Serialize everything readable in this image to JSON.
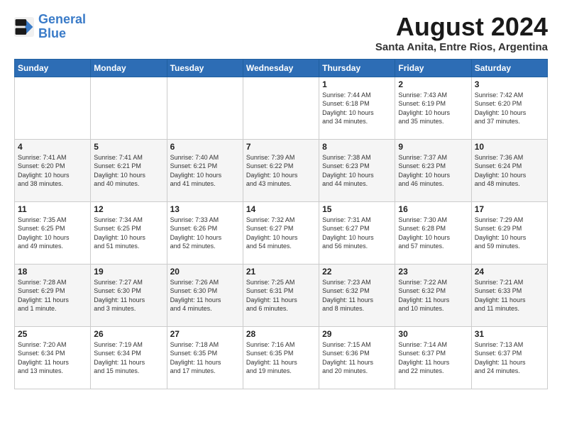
{
  "logo": {
    "line1": "General",
    "line2": "Blue"
  },
  "title": "August 2024",
  "subtitle": "Santa Anita, Entre Rios, Argentina",
  "days_of_week": [
    "Sunday",
    "Monday",
    "Tuesday",
    "Wednesday",
    "Thursday",
    "Friday",
    "Saturday"
  ],
  "weeks": [
    [
      {
        "day": "",
        "content": ""
      },
      {
        "day": "",
        "content": ""
      },
      {
        "day": "",
        "content": ""
      },
      {
        "day": "",
        "content": ""
      },
      {
        "day": "1",
        "content": "Sunrise: 7:44 AM\nSunset: 6:18 PM\nDaylight: 10 hours\nand 34 minutes."
      },
      {
        "day": "2",
        "content": "Sunrise: 7:43 AM\nSunset: 6:19 PM\nDaylight: 10 hours\nand 35 minutes."
      },
      {
        "day": "3",
        "content": "Sunrise: 7:42 AM\nSunset: 6:20 PM\nDaylight: 10 hours\nand 37 minutes."
      }
    ],
    [
      {
        "day": "4",
        "content": "Sunrise: 7:41 AM\nSunset: 6:20 PM\nDaylight: 10 hours\nand 38 minutes."
      },
      {
        "day": "5",
        "content": "Sunrise: 7:41 AM\nSunset: 6:21 PM\nDaylight: 10 hours\nand 40 minutes."
      },
      {
        "day": "6",
        "content": "Sunrise: 7:40 AM\nSunset: 6:21 PM\nDaylight: 10 hours\nand 41 minutes."
      },
      {
        "day": "7",
        "content": "Sunrise: 7:39 AM\nSunset: 6:22 PM\nDaylight: 10 hours\nand 43 minutes."
      },
      {
        "day": "8",
        "content": "Sunrise: 7:38 AM\nSunset: 6:23 PM\nDaylight: 10 hours\nand 44 minutes."
      },
      {
        "day": "9",
        "content": "Sunrise: 7:37 AM\nSunset: 6:23 PM\nDaylight: 10 hours\nand 46 minutes."
      },
      {
        "day": "10",
        "content": "Sunrise: 7:36 AM\nSunset: 6:24 PM\nDaylight: 10 hours\nand 48 minutes."
      }
    ],
    [
      {
        "day": "11",
        "content": "Sunrise: 7:35 AM\nSunset: 6:25 PM\nDaylight: 10 hours\nand 49 minutes."
      },
      {
        "day": "12",
        "content": "Sunrise: 7:34 AM\nSunset: 6:25 PM\nDaylight: 10 hours\nand 51 minutes."
      },
      {
        "day": "13",
        "content": "Sunrise: 7:33 AM\nSunset: 6:26 PM\nDaylight: 10 hours\nand 52 minutes."
      },
      {
        "day": "14",
        "content": "Sunrise: 7:32 AM\nSunset: 6:27 PM\nDaylight: 10 hours\nand 54 minutes."
      },
      {
        "day": "15",
        "content": "Sunrise: 7:31 AM\nSunset: 6:27 PM\nDaylight: 10 hours\nand 56 minutes."
      },
      {
        "day": "16",
        "content": "Sunrise: 7:30 AM\nSunset: 6:28 PM\nDaylight: 10 hours\nand 57 minutes."
      },
      {
        "day": "17",
        "content": "Sunrise: 7:29 AM\nSunset: 6:29 PM\nDaylight: 10 hours\nand 59 minutes."
      }
    ],
    [
      {
        "day": "18",
        "content": "Sunrise: 7:28 AM\nSunset: 6:29 PM\nDaylight: 11 hours\nand 1 minute."
      },
      {
        "day": "19",
        "content": "Sunrise: 7:27 AM\nSunset: 6:30 PM\nDaylight: 11 hours\nand 3 minutes."
      },
      {
        "day": "20",
        "content": "Sunrise: 7:26 AM\nSunset: 6:30 PM\nDaylight: 11 hours\nand 4 minutes."
      },
      {
        "day": "21",
        "content": "Sunrise: 7:25 AM\nSunset: 6:31 PM\nDaylight: 11 hours\nand 6 minutes."
      },
      {
        "day": "22",
        "content": "Sunrise: 7:23 AM\nSunset: 6:32 PM\nDaylight: 11 hours\nand 8 minutes."
      },
      {
        "day": "23",
        "content": "Sunrise: 7:22 AM\nSunset: 6:32 PM\nDaylight: 11 hours\nand 10 minutes."
      },
      {
        "day": "24",
        "content": "Sunrise: 7:21 AM\nSunset: 6:33 PM\nDaylight: 11 hours\nand 11 minutes."
      }
    ],
    [
      {
        "day": "25",
        "content": "Sunrise: 7:20 AM\nSunset: 6:34 PM\nDaylight: 11 hours\nand 13 minutes."
      },
      {
        "day": "26",
        "content": "Sunrise: 7:19 AM\nSunset: 6:34 PM\nDaylight: 11 hours\nand 15 minutes."
      },
      {
        "day": "27",
        "content": "Sunrise: 7:18 AM\nSunset: 6:35 PM\nDaylight: 11 hours\nand 17 minutes."
      },
      {
        "day": "28",
        "content": "Sunrise: 7:16 AM\nSunset: 6:35 PM\nDaylight: 11 hours\nand 19 minutes."
      },
      {
        "day": "29",
        "content": "Sunrise: 7:15 AM\nSunset: 6:36 PM\nDaylight: 11 hours\nand 20 minutes."
      },
      {
        "day": "30",
        "content": "Sunrise: 7:14 AM\nSunset: 6:37 PM\nDaylight: 11 hours\nand 22 minutes."
      },
      {
        "day": "31",
        "content": "Sunrise: 7:13 AM\nSunset: 6:37 PM\nDaylight: 11 hours\nand 24 minutes."
      }
    ]
  ]
}
